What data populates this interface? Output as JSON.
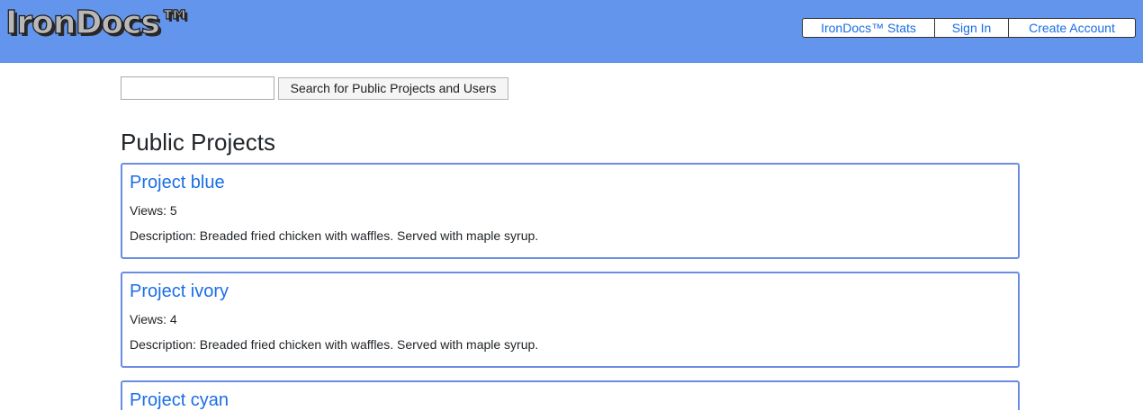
{
  "header": {
    "logo": "IronDocs™",
    "nav": [
      "IronDocs™ Stats",
      "Sign In",
      "Create Account"
    ]
  },
  "search": {
    "value": "",
    "button_label": "Search for Public Projects and Users"
  },
  "main": {
    "section_title": "Public Projects",
    "projects": [
      {
        "title": "Project blue",
        "views": "Views: 5",
        "description": "Description: Breaded fried chicken with waffles. Served with maple syrup."
      },
      {
        "title": "Project ivory",
        "views": "Views: 4",
        "description": "Description: Breaded fried chicken with waffles. Served with maple syrup."
      },
      {
        "title": "Project cyan",
        "views": "",
        "description": ""
      }
    ]
  },
  "colors": {
    "header_bg": "#6495ed",
    "link": "#1a6ee6",
    "card_border": "#6a8de3"
  }
}
